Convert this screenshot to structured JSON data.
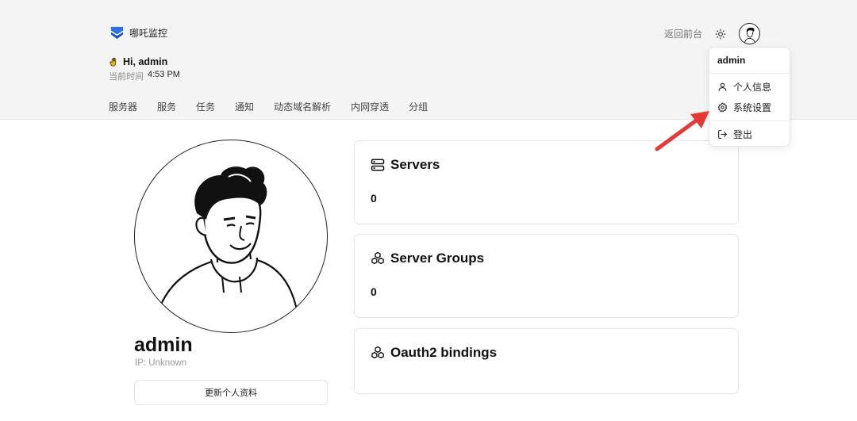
{
  "header": {
    "brand_name": "哪吒监控",
    "back_link": "返回前台",
    "greeting": "Hi, admin",
    "time_label": "当前时间",
    "time_value": "4:53 PM"
  },
  "nav": {
    "items": [
      {
        "label": "服务器"
      },
      {
        "label": "服务"
      },
      {
        "label": "任务"
      },
      {
        "label": "通知"
      },
      {
        "label": "动态域名解析"
      },
      {
        "label": "内网穿透"
      },
      {
        "label": "分组"
      }
    ]
  },
  "profile": {
    "name": "admin",
    "ip": "IP: Unknown",
    "update_button": "更新个人资料"
  },
  "cards": [
    {
      "title": "Servers",
      "value": "0",
      "icon": "server-icon"
    },
    {
      "title": "Server Groups",
      "value": "0",
      "icon": "boxes-icon"
    },
    {
      "title": "Oauth2 bindings",
      "icon": "boxes-icon"
    }
  ],
  "dropdown": {
    "username": "admin",
    "items": [
      {
        "label": "个人信息",
        "icon": "user-icon"
      },
      {
        "label": "系统设置",
        "icon": "gear-icon"
      },
      {
        "label": "登出",
        "icon": "logout-icon"
      }
    ]
  },
  "colors": {
    "brand_blue": "#2f6fe6",
    "annotation_arrow": "#e53935",
    "header_bg": "#f4f4f4"
  }
}
